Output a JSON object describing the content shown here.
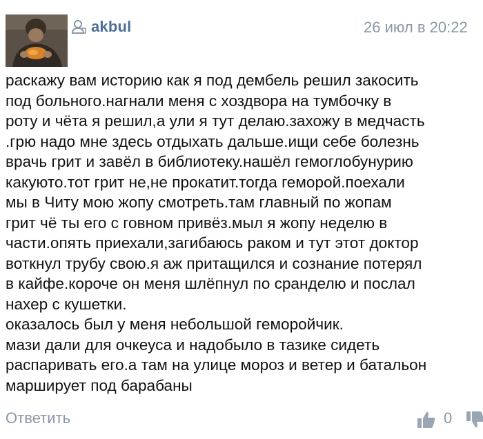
{
  "comment": {
    "author": "akbul",
    "timestamp": "26 июл в 20:22",
    "body_lines": [
      "раскажу вам историю как я под дембель решил закосить",
      "под больного.нагнали меня с хоздвора на тумбочку в",
      "роту и чёта я решил,а ули я тут делаю.захожу в медчасть",
      ".грю надо мне здесь отдыхать дальше.ищи себе болезнь",
      "врачь грит и завёл в библиотеку.нашёл гемоглобунурию",
      "какуюто.тот грит не,не прокатит.тогда геморой.поехали",
      "мы в Читу мою жопу смотреть.там главный по жопам",
      "грит чё ты его с говном привёз.мыл я жопу неделю в",
      "части.опять приехали,загибаюсь раком и тут этот доктор",
      "воткнул трубу свою.я аж притащился и сознание потерял",
      "в кайфе.короче он меня шлёпнул по сранделю и послал",
      "нахер с кушетки.",
      "оказалось был у меня небольшой геморойчик.",
      "мази дали для очкеуса и надобыло в тазике сидеть",
      "распаривать его.а там на улице мороз и ветер и батальон",
      "марширует под барабаны"
    ],
    "reply_label": "Ответить",
    "like_count": "0"
  },
  "icons": {
    "avatar": "user-photo",
    "author_icon": "user-icon",
    "like": "thumbs-up-icon",
    "dislike": "thumbs-down-icon"
  },
  "colors": {
    "author": "#4d6f96",
    "meta": "#8a97a6",
    "text": "#111111"
  }
}
